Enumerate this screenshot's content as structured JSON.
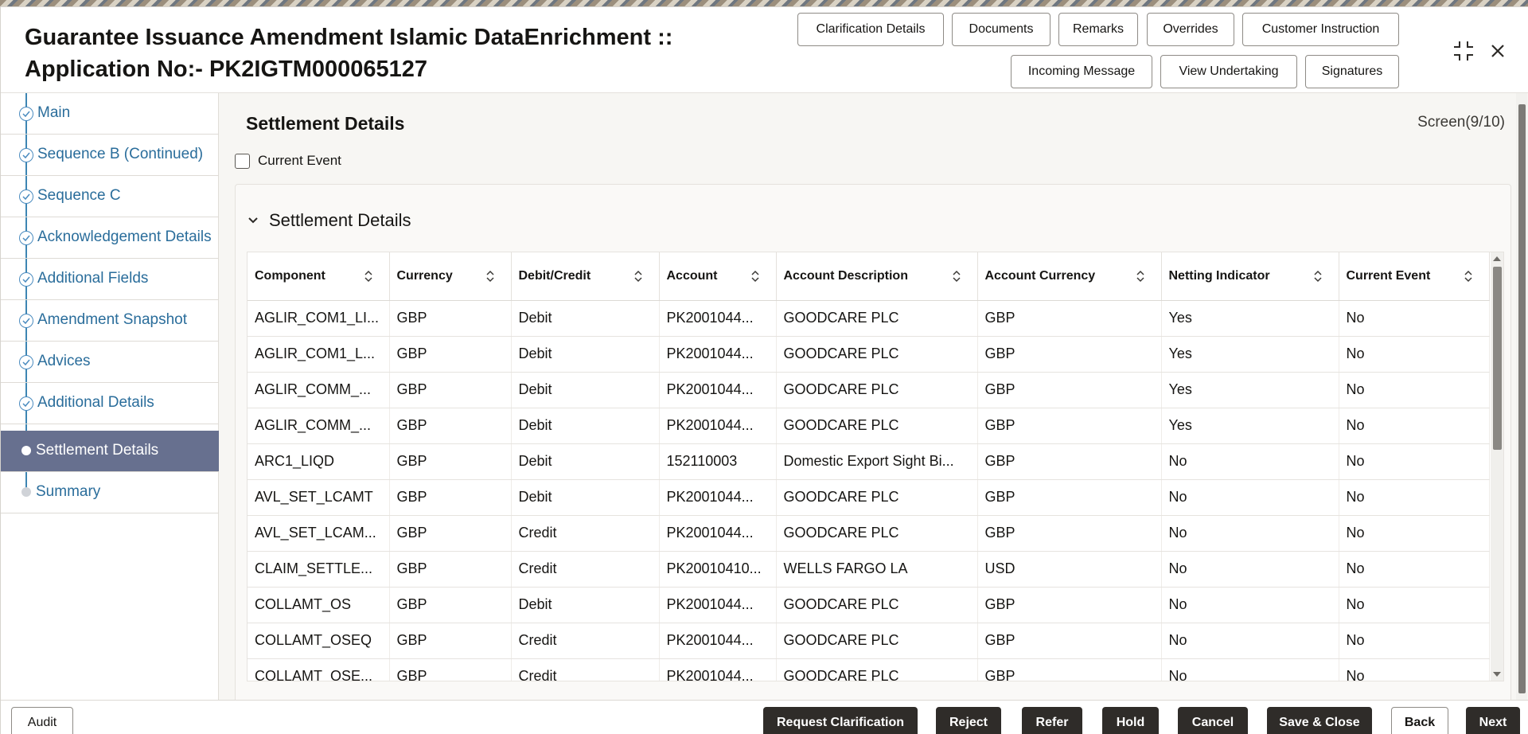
{
  "header": {
    "title_line1": "Guarantee Issuance Amendment Islamic DataEnrichment ::",
    "title_line2": "Application No:- PK2IGTM000065127",
    "buttons": {
      "clarification": "Clarification Details",
      "documents": "Documents",
      "remarks": "Remarks",
      "overrides": "Overrides",
      "customer_instruction": "Customer Instruction",
      "incoming_message": "Incoming Message",
      "view_undertaking": "View Undertaking",
      "signatures": "Signatures"
    }
  },
  "sidebar": {
    "items": [
      {
        "label": "Main",
        "state": "done"
      },
      {
        "label": "Sequence B (Continued)",
        "state": "done"
      },
      {
        "label": "Sequence C",
        "state": "done"
      },
      {
        "label": "Acknowledgement Details",
        "state": "done"
      },
      {
        "label": "Additional Fields",
        "state": "done"
      },
      {
        "label": "Amendment Snapshot",
        "state": "done"
      },
      {
        "label": "Advices",
        "state": "done"
      },
      {
        "label": "Additional Details",
        "state": "done"
      },
      {
        "label": "Settlement Details",
        "state": "active"
      },
      {
        "label": "Summary",
        "state": "pending"
      }
    ]
  },
  "main": {
    "heading": "Settlement Details",
    "screen_count": "Screen(9/10)",
    "current_event_label": "Current Event",
    "current_event_checked": false,
    "section_title": "Settlement Details",
    "table": {
      "columns": [
        "Component",
        "Currency",
        "Debit/Credit",
        "Account",
        "Account Description",
        "Account Currency",
        "Netting Indicator",
        "Current Event"
      ],
      "rows": [
        [
          "AGLIR_COM1_LI...",
          "GBP",
          "Debit",
          "PK2001044...",
          "GOODCARE PLC",
          "GBP",
          "Yes",
          "No"
        ],
        [
          "AGLIR_COM1_L...",
          "GBP",
          "Debit",
          "PK2001044...",
          "GOODCARE PLC",
          "GBP",
          "Yes",
          "No"
        ],
        [
          "AGLIR_COMM_...",
          "GBP",
          "Debit",
          "PK2001044...",
          "GOODCARE PLC",
          "GBP",
          "Yes",
          "No"
        ],
        [
          "AGLIR_COMM_...",
          "GBP",
          "Debit",
          "PK2001044...",
          "GOODCARE PLC",
          "GBP",
          "Yes",
          "No"
        ],
        [
          "ARC1_LIQD",
          "GBP",
          "Debit",
          "152110003",
          "Domestic Export Sight Bi...",
          "GBP",
          "No",
          "No"
        ],
        [
          "AVL_SET_LCAMT",
          "GBP",
          "Debit",
          "PK2001044...",
          "GOODCARE PLC",
          "GBP",
          "No",
          "No"
        ],
        [
          "AVL_SET_LCAM...",
          "GBP",
          "Credit",
          "PK2001044...",
          "GOODCARE PLC",
          "GBP",
          "No",
          "No"
        ],
        [
          "CLAIM_SETTLE...",
          "GBP",
          "Credit",
          "PK20010410...",
          "WELLS FARGO LA",
          "USD",
          "No",
          "No"
        ],
        [
          "COLLAMT_OS",
          "GBP",
          "Debit",
          "PK2001044...",
          "GOODCARE PLC",
          "GBP",
          "No",
          "No"
        ],
        [
          "COLLAMT_OSEQ",
          "GBP",
          "Credit",
          "PK2001044...",
          "GOODCARE PLC",
          "GBP",
          "No",
          "No"
        ],
        [
          "COLLAMT_OSE...",
          "GBP",
          "Credit",
          "PK2001044...",
          "GOODCARE PLC",
          "GBP",
          "No",
          "No"
        ]
      ]
    }
  },
  "footer": {
    "audit": "Audit",
    "request_clarification": "Request Clarification",
    "reject": "Reject",
    "refer": "Refer",
    "hold": "Hold",
    "cancel": "Cancel",
    "save_close": "Save & Close",
    "back": "Back",
    "next": "Next"
  },
  "icons": {
    "minimize": "collapse-arrows-icon",
    "close": "close-icon",
    "section_toggle": "chevron-down-icon",
    "sort": "sort-icon",
    "step_done": "check-circle-icon"
  },
  "colors": {
    "accent_link": "#2a6d9b",
    "active_nav": "#67708f",
    "primary_button": "#2f2c29"
  }
}
